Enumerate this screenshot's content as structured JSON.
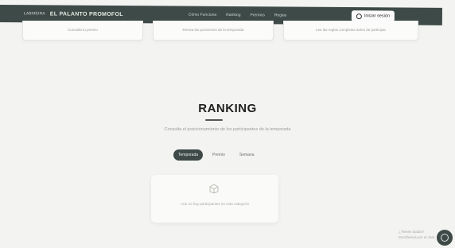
{
  "header": {
    "brand_small": "LABMEIRA",
    "brand": "EL PALANTO PROMOFOL",
    "nav": [
      "Cómo Funciona",
      "Ranking",
      "Premios",
      "Reglas"
    ],
    "login_label": "Iniciar sesión"
  },
  "cards": [
    {
      "text": "Consulta tu premio"
    },
    {
      "text": "Revisa las posiciones de la temporada"
    },
    {
      "text": "Lee las reglas completas antes de participar"
    }
  ],
  "ranking": {
    "title": "RANKING",
    "subtitle": "Consulta el posicionamiento de los participantes de la temporada",
    "tabs": [
      {
        "label": "Temporada",
        "active": true
      },
      {
        "label": "Premio",
        "active": false
      },
      {
        "label": "Semana",
        "active": false
      }
    ],
    "empty_text": "Aún no hay participantes en esta categoría"
  },
  "floating": {
    "line1": "¿Tienes dudas?",
    "line2": "Escríbenos por el chat"
  }
}
